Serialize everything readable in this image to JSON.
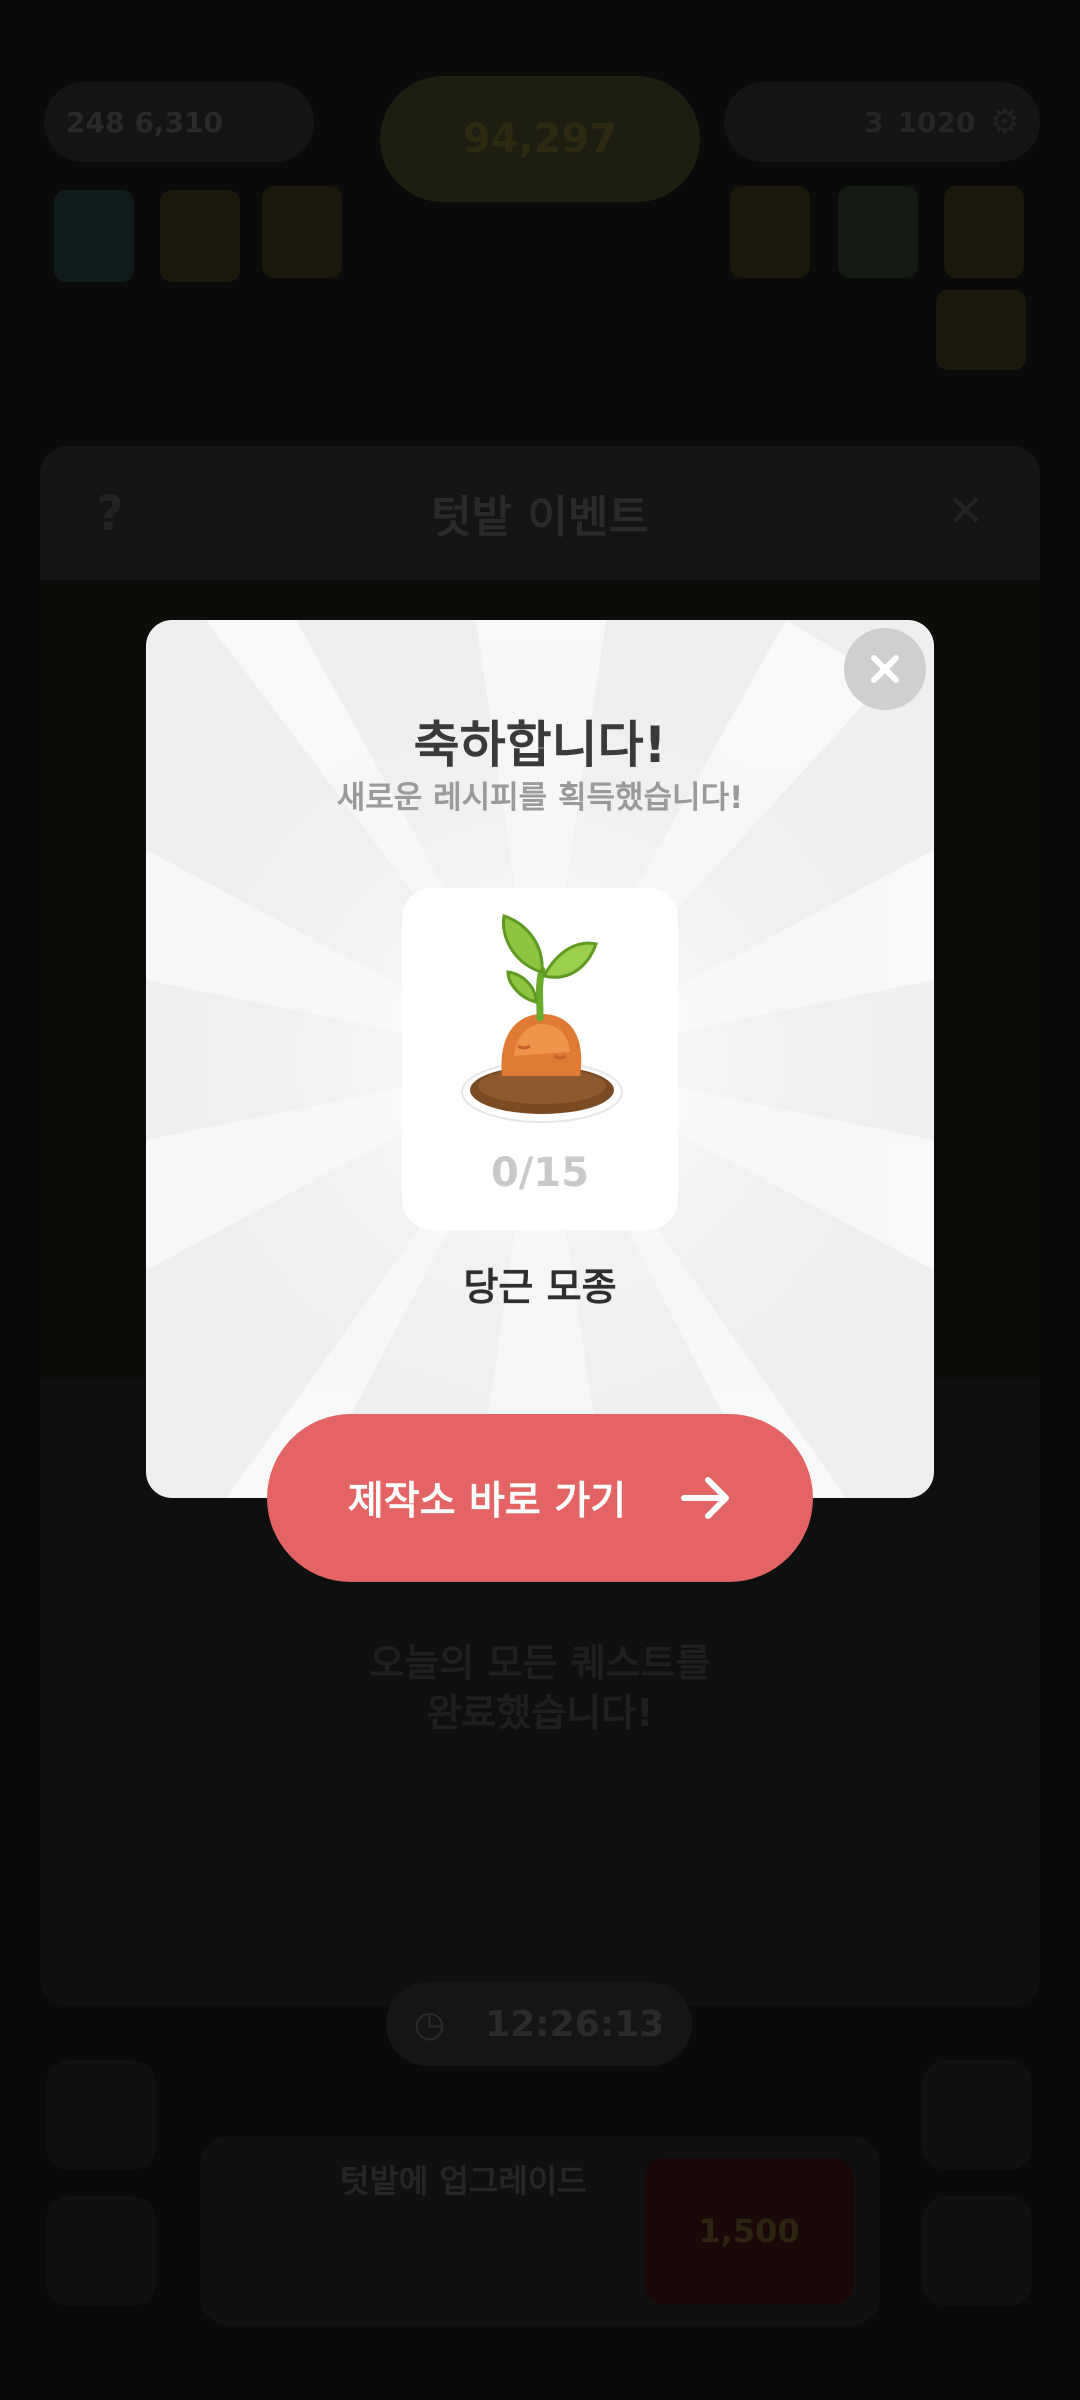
{
  "background": {
    "resources_left": {
      "value1": "248",
      "value2": "6,310"
    },
    "coin_pill": {
      "amount": "94,297",
      "note": ""
    },
    "resources_right": {
      "value1": "3",
      "value2": "1020"
    },
    "event_panel": {
      "title": "텃밭 이벤트",
      "help_glyph": "?",
      "close_glyph": "✕",
      "message_line1": "오늘의 모든 퀘스트를",
      "message_line2": "완료했습니다!"
    },
    "timer": "12:26:13",
    "bottom_bar": {
      "title": "텃밭에 업그레이드",
      "subtitle": "",
      "button_label": "1,500"
    }
  },
  "modal": {
    "title": "축하합니다!",
    "subtitle": "새로운 레시피를 획득했습니다!",
    "item": {
      "name": "당근 모종",
      "count": "0/15",
      "icon": "carrot-seedling-icon"
    },
    "close_icon": "close-icon",
    "go_button_label": "제작소 바로 가기",
    "go_button_icon": "arrow-right-icon"
  },
  "colors": {
    "accent_button": "#e46463",
    "modal_bg": "#efefef",
    "overlay": "#0a0a0a"
  }
}
